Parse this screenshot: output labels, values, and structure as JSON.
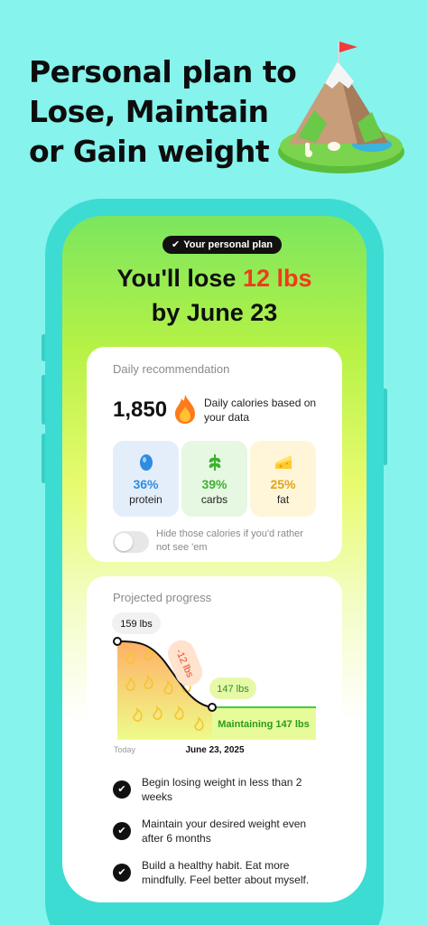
{
  "headline": "Personal plan to Lose, Maintain or Gain weight",
  "badge": {
    "check_icon": "check-icon",
    "label": "Your personal plan"
  },
  "title": {
    "prefix": "You'll lose ",
    "highlight": "12 lbs",
    "line2": "by June 23"
  },
  "daily": {
    "label": "Daily recommendation",
    "calories": "1,850",
    "calories_icon": "fire-icon",
    "calories_desc": "Daily calories based on your data",
    "macros": [
      {
        "icon": "egg-icon",
        "pct": "36%",
        "name": "protein",
        "bg": "#e4eefb",
        "color": "#2f8be0"
      },
      {
        "icon": "leaf-icon",
        "pct": "39%",
        "name": "carbs",
        "bg": "#e6f7e2",
        "color": "#3eb22f"
      },
      {
        "icon": "cheese-icon",
        "pct": "25%",
        "name": "fat",
        "bg": "#fff6d9",
        "color": "#e0a51a"
      }
    ],
    "toggle_label": "Hide those calories if you'd rather not see 'em",
    "toggle_on": false
  },
  "progress": {
    "label": "Projected progress",
    "start_label": "159 lbs",
    "change_label": "-12 lbs",
    "end_label": "147 lbs",
    "maintain_label": "Maintaining 147 lbs",
    "x_start": "Today",
    "x_end": "June 23, 2025"
  },
  "chart_data": {
    "type": "line",
    "x": [
      "Today",
      "June 23, 2025"
    ],
    "values": [
      159,
      147
    ],
    "annotations": [
      "159 lbs",
      "-12 lbs",
      "147 lbs",
      "Maintaining 147 lbs"
    ]
  },
  "goals": [
    "Begin losing weight in less than 2 weeks",
    "Maintain your desired weight even after 6 months",
    "Build a healthy habit. Eat more mindfully. Feel better about myself."
  ],
  "colors": {
    "accent_red": "#ef3b1c",
    "accent_green": "#3eb22f",
    "background": "#86f3ec",
    "phone_frame": "#3ddcd3"
  }
}
